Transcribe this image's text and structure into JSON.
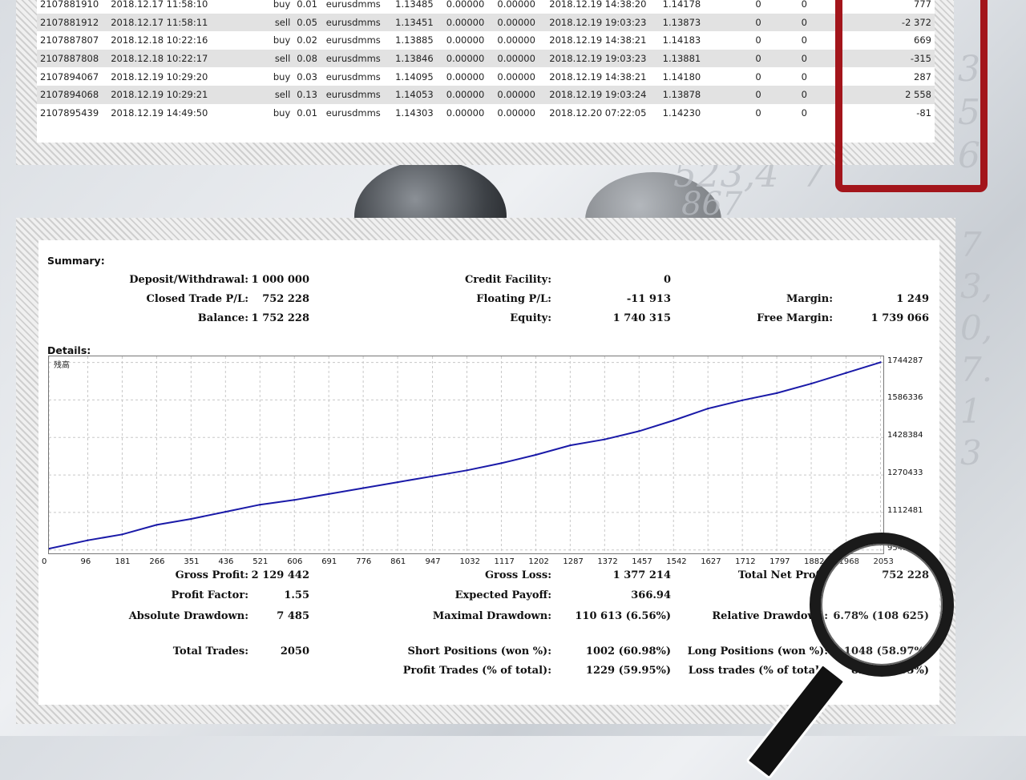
{
  "trades": {
    "rows": [
      {
        "ticket": "2107881910",
        "open_time": "2018.12.17 11:58:10",
        "type": "buy",
        "size": "0.01",
        "item": "eurusdmms",
        "price": "1.13485",
        "sl": "0.00000",
        "tp": "0.00000",
        "close_time": "2018.12.19 14:38:20",
        "close_price": "1.14178",
        "commission": "0",
        "taxes": "0",
        "swap": "0",
        "profit": "777"
      },
      {
        "ticket": "2107881912",
        "open_time": "2018.12.17 11:58:11",
        "type": "sell",
        "size": "0.05",
        "item": "eurusdmms",
        "price": "1.13451",
        "sl": "0.00000",
        "tp": "0.00000",
        "close_time": "2018.12.19 19:03:23",
        "close_price": "1.13873",
        "commission": "0",
        "taxes": "0",
        "swap": "0",
        "profit": "-2 372"
      },
      {
        "ticket": "2107887807",
        "open_time": "2018.12.18 10:22:16",
        "type": "buy",
        "size": "0.02",
        "item": "eurusdmms",
        "price": "1.13885",
        "sl": "0.00000",
        "tp": "0.00000",
        "close_time": "2018.12.19 14:38:21",
        "close_price": "1.14183",
        "commission": "0",
        "taxes": "0",
        "swap": "0",
        "profit": "669"
      },
      {
        "ticket": "2107887808",
        "open_time": "2018.12.18 10:22:17",
        "type": "sell",
        "size": "0.08",
        "item": "eurusdmms",
        "price": "1.13846",
        "sl": "0.00000",
        "tp": "0.00000",
        "close_time": "2018.12.19 19:03:23",
        "close_price": "1.13881",
        "commission": "0",
        "taxes": "0",
        "swap": "0",
        "profit": "-315"
      },
      {
        "ticket": "2107894067",
        "open_time": "2018.12.19 10:29:20",
        "type": "buy",
        "size": "0.03",
        "item": "eurusdmms",
        "price": "1.14095",
        "sl": "0.00000",
        "tp": "0.00000",
        "close_time": "2018.12.19 14:38:21",
        "close_price": "1.14180",
        "commission": "0",
        "taxes": "0",
        "swap": "0",
        "profit": "287"
      },
      {
        "ticket": "2107894068",
        "open_time": "2018.12.19 10:29:21",
        "type": "sell",
        "size": "0.13",
        "item": "eurusdmms",
        "price": "1.14053",
        "sl": "0.00000",
        "tp": "0.00000",
        "close_time": "2018.12.19 19:03:24",
        "close_price": "1.13878",
        "commission": "0",
        "taxes": "0",
        "swap": "0",
        "profit": "2 558"
      },
      {
        "ticket": "2107895439",
        "open_time": "2018.12.19 14:49:50",
        "type": "buy",
        "size": "0.01",
        "item": "eurusdmms",
        "price": "1.14303",
        "sl": "0.00000",
        "tp": "0.00000",
        "close_time": "2018.12.20 07:22:05",
        "close_price": "1.14230",
        "commission": "0",
        "taxes": "0",
        "swap": "0",
        "profit": "-81"
      }
    ]
  },
  "summary": {
    "heading": "Summary:",
    "deposit_label": "Deposit/Withdrawal:",
    "deposit_value": "1 000 000",
    "credit_label": "Credit Facility:",
    "credit_value": "0",
    "closed_pl_label": "Closed Trade P/L:",
    "closed_pl_value": "752 228",
    "floating_label": "Floating P/L:",
    "floating_value": "-11 913",
    "margin_label": "Margin:",
    "margin_value": "1 249",
    "balance_label": "Balance:",
    "balance_value": "1 752 228",
    "equity_label": "Equity:",
    "equity_value": "1 740 315",
    "free_margin_label": "Free Margin:",
    "free_margin_value": "1 739 066"
  },
  "details": {
    "heading": "Details:",
    "gross_profit_label": "Gross Profit:",
    "gross_profit_value": "2 129 442",
    "gross_loss_label": "Gross Loss:",
    "gross_loss_value": "1 377 214",
    "net_profit_label": "Total Net Profit",
    "net_profit_value": "752 228",
    "profit_factor_label": "Profit Factor:",
    "profit_factor_value": "1.55",
    "expected_payoff_label": "Expected Payoff:",
    "expected_payoff_value": "366.94",
    "abs_dd_label": "Absolute Drawdown:",
    "abs_dd_value": "7 485",
    "max_dd_label": "Maximal Drawdown:",
    "max_dd_value": "110 613 (6.56%)",
    "rel_dd_label": "Relative Drawdown:",
    "rel_dd_value": "6.78% (108 625)",
    "total_trades_label": "Total Trades:",
    "total_trades_value": "2050",
    "short_label": "Short Positions (won %):",
    "short_value": "1002 (60.98%)",
    "long_label": "Long Positions (won %):",
    "long_value": "1048 (58.97%)",
    "profit_trades_label": "Profit Trades (% of total):",
    "profit_trades_value": "1229 (59.95%)",
    "loss_trades_label": "Loss trades (% of total):",
    "loss_trades_value": "821 (40.05%)"
  },
  "chart_data": {
    "type": "line",
    "legend": "残高",
    "line_color": "#1a1aa8",
    "x_ticks": [
      0,
      96,
      181,
      266,
      351,
      436,
      521,
      606,
      691,
      776,
      861,
      947,
      1032,
      1117,
      1202,
      1287,
      1372,
      1457,
      1542,
      1627,
      1712,
      1797,
      1882,
      1968,
      2053
    ],
    "y_ticks": [
      954529,
      1112481,
      1270433,
      1428384,
      1586336,
      1744287
    ],
    "xlim": [
      0,
      2060
    ],
    "ylim": [
      940000,
      1770000
    ],
    "series": [
      {
        "x": [
          0,
          96,
          181,
          266,
          351,
          436,
          521,
          606,
          691,
          776,
          861,
          947,
          1032,
          1117,
          1202,
          1287,
          1372,
          1457,
          1542,
          1627,
          1712,
          1797,
          1882,
          1968,
          2053
        ],
        "y": [
          960000,
          995000,
          1020000,
          1060000,
          1085000,
          1115000,
          1145000,
          1165000,
          1190000,
          1215000,
          1240000,
          1265000,
          1290000,
          1320000,
          1355000,
          1395000,
          1420000,
          1455000,
          1500000,
          1550000,
          1585000,
          1615000,
          1655000,
          1700000,
          1745000
        ]
      }
    ],
    "grid": true
  }
}
